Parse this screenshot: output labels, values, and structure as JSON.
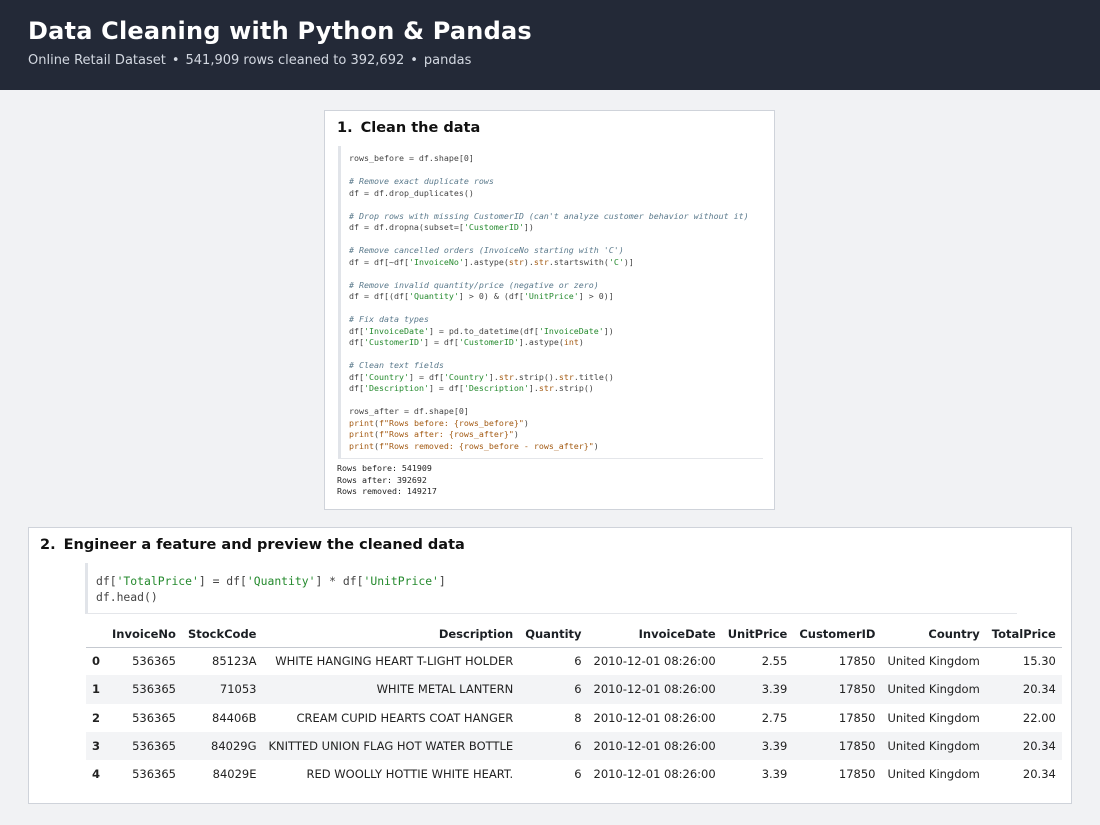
{
  "header": {
    "title": "Data Cleaning with Python & Pandas",
    "subtitle_dataset": "Online Retail Dataset",
    "subtitle_rows": "541,909 rows cleaned to 392,692",
    "subtitle_lib": "pandas",
    "separator": "•"
  },
  "cell1": {
    "number": "1.",
    "title": "Clean the data",
    "code_lines": [
      [
        [
          "rows_before = df.shape[0]",
          ""
        ]
      ],
      [],
      [
        [
          "# Remove exact duplicate rows",
          "cm"
        ]
      ],
      [
        [
          "df = df.drop_duplicates()",
          ""
        ]
      ],
      [],
      [
        [
          "# Drop rows with missing CustomerID (can't analyze customer behavior without it)",
          "cm"
        ]
      ],
      [
        [
          "df = df.dropna(subset=[",
          ""
        ],
        [
          "'CustomerID'",
          "st"
        ],
        [
          "])",
          ""
        ]
      ],
      [],
      [
        [
          "# Remove cancelled orders (InvoiceNo starting with 'C')",
          "cm"
        ]
      ],
      [
        [
          "df = df[~df[",
          ""
        ],
        [
          "'InvoiceNo'",
          "st"
        ],
        [
          "].astype(",
          ""
        ],
        [
          "str",
          "kw"
        ],
        [
          ").",
          ""
        ],
        [
          "str",
          "kw"
        ],
        [
          ".startswith(",
          ""
        ],
        [
          "'C'",
          "st"
        ],
        [
          ")]",
          ""
        ]
      ],
      [],
      [
        [
          "# Remove invalid quantity/price (negative or zero)",
          "cm"
        ]
      ],
      [
        [
          "df = df[(df[",
          ""
        ],
        [
          "'Quantity'",
          "st"
        ],
        [
          "] > 0) & (df[",
          ""
        ],
        [
          "'UnitPrice'",
          "st"
        ],
        [
          "] > 0)]",
          ""
        ]
      ],
      [],
      [
        [
          "# Fix data types",
          "cm"
        ]
      ],
      [
        [
          "df[",
          ""
        ],
        [
          "'InvoiceDate'",
          "st"
        ],
        [
          "] = pd.to_datetime(df[",
          ""
        ],
        [
          "'InvoiceDate'",
          "st"
        ],
        [
          "])",
          ""
        ]
      ],
      [
        [
          "df[",
          ""
        ],
        [
          "'CustomerID'",
          "st"
        ],
        [
          "] = df[",
          ""
        ],
        [
          "'CustomerID'",
          "st"
        ],
        [
          "].astype(",
          ""
        ],
        [
          "int",
          "kw"
        ],
        [
          ")",
          ""
        ]
      ],
      [],
      [
        [
          "# Clean text fields",
          "cm"
        ]
      ],
      [
        [
          "df[",
          ""
        ],
        [
          "'Country'",
          "st"
        ],
        [
          "] = df[",
          ""
        ],
        [
          "'Country'",
          "st"
        ],
        [
          "].",
          ""
        ],
        [
          "str",
          "kw"
        ],
        [
          ".strip().",
          ""
        ],
        [
          "str",
          "kw"
        ],
        [
          ".title()",
          ""
        ]
      ],
      [
        [
          "df[",
          ""
        ],
        [
          "'Description'",
          "st"
        ],
        [
          "] = df[",
          ""
        ],
        [
          "'Description'",
          "st"
        ],
        [
          "].",
          ""
        ],
        [
          "str",
          "kw"
        ],
        [
          ".strip()",
          ""
        ]
      ],
      [],
      [
        [
          "rows_after = df.shape[0]",
          ""
        ]
      ],
      [
        [
          "print",
          "kw"
        ],
        [
          "(",
          ""
        ],
        [
          "f\"Rows before: {rows_before}\"",
          "kw"
        ],
        [
          ")",
          ""
        ]
      ],
      [
        [
          "print",
          "kw"
        ],
        [
          "(",
          ""
        ],
        [
          "f\"Rows after: {rows_after}\"",
          "kw"
        ],
        [
          ")",
          ""
        ]
      ],
      [
        [
          "print",
          "kw"
        ],
        [
          "(",
          ""
        ],
        [
          "f\"Rows removed: {rows_before - rows_after}\"",
          "kw"
        ],
        [
          ")",
          ""
        ]
      ]
    ],
    "output_lines": [
      "Rows before: 541909",
      "Rows after: 392692",
      "Rows removed: 149217"
    ]
  },
  "cell2": {
    "number": "2.",
    "title": "Engineer a feature and preview the cleaned data",
    "code_lines": [
      [
        [
          "df[",
          ""
        ],
        [
          "'TotalPrice'",
          "st"
        ],
        [
          "] = df[",
          ""
        ],
        [
          "'Quantity'",
          "st"
        ],
        [
          "] * df[",
          ""
        ],
        [
          "'UnitPrice'",
          "st"
        ],
        [
          "]",
          ""
        ]
      ],
      [
        [
          "df.head()",
          ""
        ]
      ]
    ],
    "table": {
      "columns": [
        "",
        "InvoiceNo",
        "StockCode",
        "Description",
        "Quantity",
        "InvoiceDate",
        "UnitPrice",
        "CustomerID",
        "Country",
        "TotalPrice"
      ],
      "rows": [
        [
          "0",
          "536365",
          "85123A",
          "WHITE HANGING HEART T-LIGHT HOLDER",
          "6",
          "2010-12-01 08:26:00",
          "2.55",
          "17850",
          "United Kingdom",
          "15.30"
        ],
        [
          "1",
          "536365",
          "71053",
          "WHITE METAL LANTERN",
          "6",
          "2010-12-01 08:26:00",
          "3.39",
          "17850",
          "United Kingdom",
          "20.34"
        ],
        [
          "2",
          "536365",
          "84406B",
          "CREAM CUPID HEARTS COAT HANGER",
          "8",
          "2010-12-01 08:26:00",
          "2.75",
          "17850",
          "United Kingdom",
          "22.00"
        ],
        [
          "3",
          "536365",
          "84029G",
          "KNITTED UNION FLAG HOT WATER BOTTLE",
          "6",
          "2010-12-01 08:26:00",
          "3.39",
          "17850",
          "United Kingdom",
          "20.34"
        ],
        [
          "4",
          "536365",
          "84029E",
          "RED WOOLLY HOTTIE WHITE HEART.",
          "6",
          "2010-12-01 08:26:00",
          "3.39",
          "17850",
          "United Kingdom",
          "20.34"
        ]
      ]
    }
  },
  "colors": {
    "header_bg": "#232937",
    "page_bg": "#f1f2f4",
    "comment": "#5b7a8c",
    "string": "#258a2e",
    "keyword": "#a35a12"
  }
}
